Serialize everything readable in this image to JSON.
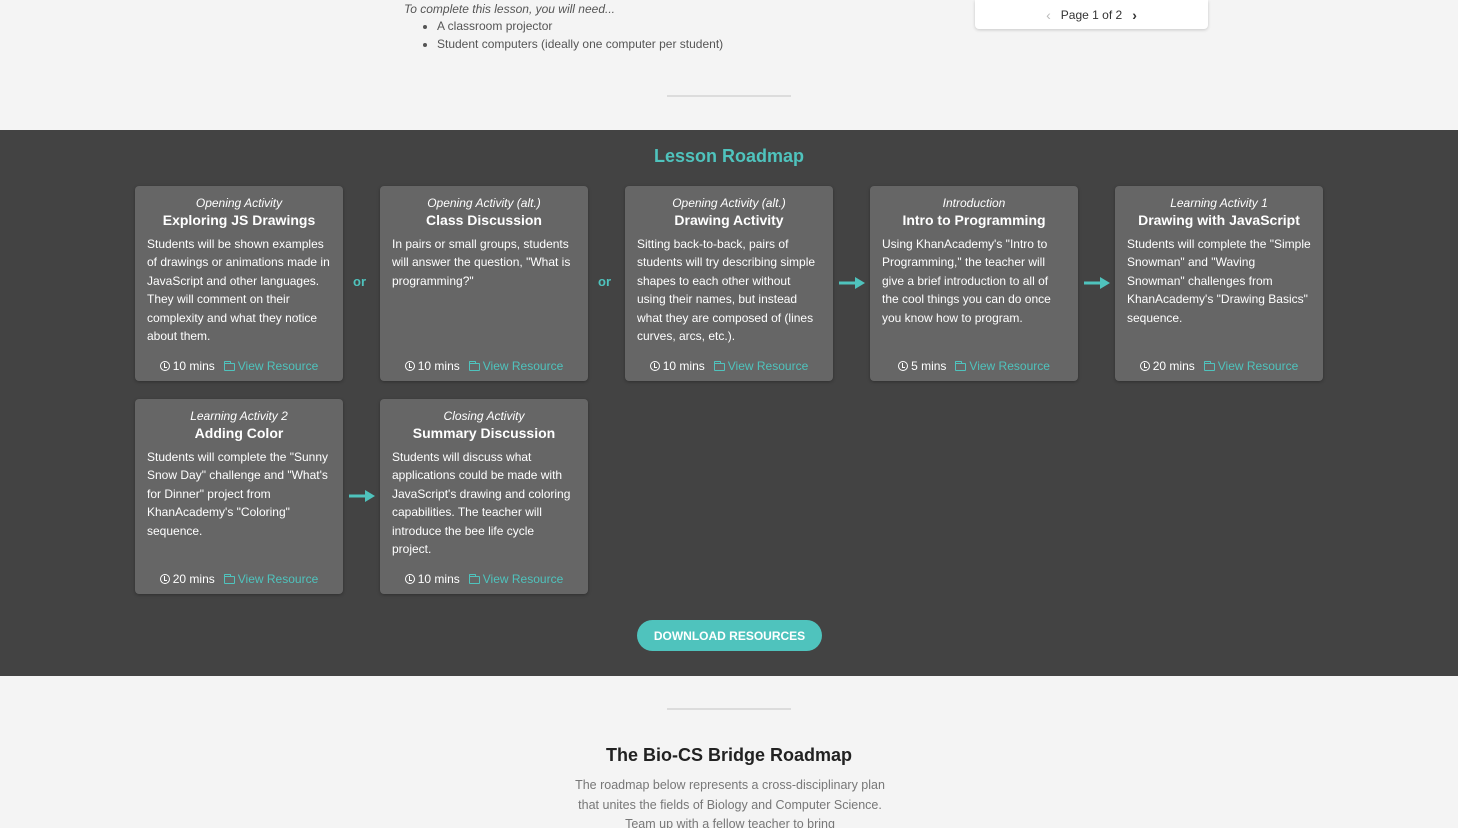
{
  "needs": {
    "title": "To complete this lesson, you will need...",
    "items": [
      "A classroom projector",
      "Student computers (ideally one computer per student)"
    ]
  },
  "pager": {
    "label": "Page 1 of 2"
  },
  "roadmap": {
    "title": "Lesson Roadmap",
    "connector_or": "or",
    "accent_color": "#4fc3bd",
    "view_resource_label": "View Resource",
    "cards": [
      {
        "kicker": "Opening Activity",
        "title": "Exploring JS Drawings",
        "desc": "Students will be shown examples of drawings or animations made in JavaScript and other languages. They will comment on their complexity and what they notice about them.",
        "time": "10 mins"
      },
      {
        "kicker": "Opening Activity (alt.)",
        "title": "Class Discussion",
        "desc": "In pairs or small groups, students will answer the question, \"What is programming?\"",
        "time": "10 mins"
      },
      {
        "kicker": "Opening Activity (alt.)",
        "title": "Drawing Activity",
        "desc": "Sitting back-to-back, pairs of students will try describing simple shapes to each other without using their names, but instead what they are composed of (lines curves, arcs, etc.).",
        "time": "10 mins"
      },
      {
        "kicker": "Introduction",
        "title": "Intro to Programming",
        "desc": "Using KhanAcademy's \"Intro to Programming,\" the teacher will give a brief introduction to all of the cool things you can do once you know how to program.",
        "time": "5 mins"
      },
      {
        "kicker": "Learning Activity 1",
        "title": "Drawing with JavaScript",
        "desc": "Students will complete the \"Simple Snowman\" and \"Waving Snowman\" challenges from KhanAcademy's \"Drawing Basics\" sequence.",
        "time": "20 mins"
      },
      {
        "kicker": "Learning Activity 2",
        "title": "Adding Color",
        "desc": "Students will complete the \"Sunny Snow Day\" challenge and \"What's for Dinner\" project from KhanAcademy's \"Coloring\" sequence.",
        "time": "20 mins"
      },
      {
        "kicker": "Closing Activity",
        "title": "Summary Discussion",
        "desc": "Students will discuss what applications could be made with JavaScript's drawing and coloring capabilities. The teacher will introduce the bee life cycle project.",
        "time": "10 mins"
      }
    ],
    "download_label": "DOWNLOAD RESOURCES"
  },
  "bio": {
    "title": "The Bio-CS Bridge Roadmap",
    "desc": "The roadmap below represents a cross-disciplinary plan that unites the fields of Biology and Computer Science. Team up with a fellow teacher to bring"
  }
}
